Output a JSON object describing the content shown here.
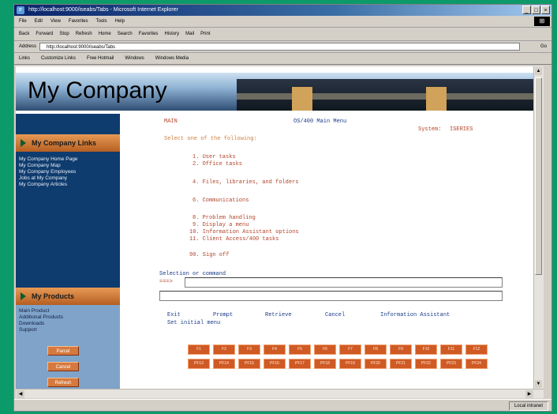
{
  "browser": {
    "title": "http://localhost:9000/iseabs/Tabs - Microsoft Internet Explorer",
    "menu": [
      "File",
      "Edit",
      "View",
      "Favorites",
      "Tools",
      "Help"
    ],
    "toolbar": [
      "Back",
      "Forward",
      "Stop",
      "Refresh",
      "Home",
      "Search",
      "Favorites",
      "History",
      "Mail",
      "Print"
    ],
    "address_label": "Address",
    "address_value": "http://localhost:9000/iseabs/Tabs",
    "go_label": "Go",
    "links_label": "Links",
    "links": [
      "Customize Links",
      "Free Hotmail",
      "Windows",
      "Windows Media"
    ],
    "status_left": "",
    "status_zone": "Local intranet"
  },
  "site": {
    "title": "My Company"
  },
  "sidebar": {
    "section1_title": "My Company Links",
    "section1_links": [
      "My Company Home Page",
      "My Company Map",
      "My Company Employees",
      "Jobs at My Company",
      "My Company Articles"
    ],
    "section2_title": "My Products",
    "section2_links": [
      "Main Product",
      "Additional Products",
      "Downloads",
      "Support"
    ],
    "buttons": [
      "Parcel",
      "Cancel",
      "Refresh"
    ]
  },
  "screen": {
    "id": "MAIN",
    "heading": "OS/400 Main Menu",
    "system_label": "System:",
    "system_value": "ISERIES",
    "prompt": "Select one of the following:",
    "options": [
      "1. User tasks",
      "2. Office tasks",
      "4. Files, libraries, and folders",
      "6. Communications",
      "8. Problem handling",
      "9. Display a menu",
      "10. Information Assistant options",
      "11. Client Access/400 tasks",
      "90. Sign off"
    ],
    "selection_label": "Selection or command",
    "cmd_prompt": "===>",
    "command_value": "",
    "actions": [
      "Exit",
      "Prompt",
      "Retrieve",
      "Cancel",
      "Information Assistant"
    ],
    "action2": "Set initial menu",
    "fkeys_row1": [
      "F1",
      "F2",
      "F3",
      "F4",
      "F5",
      "F6",
      "F7",
      "F8",
      "F9",
      "F10",
      "F11",
      "F12"
    ],
    "fkeys_row2": [
      "PF13",
      "PF14",
      "PF15",
      "PF16",
      "PF17",
      "PF18",
      "PF19",
      "PF20",
      "PF21",
      "PF22",
      "PF23",
      "PF24"
    ]
  },
  "colors": {
    "bg_teal": "#0d9a6a",
    "sidebar_blue": "#0f3c6e",
    "accent_orange": "#cf5a24",
    "text_red": "#b2442a"
  }
}
